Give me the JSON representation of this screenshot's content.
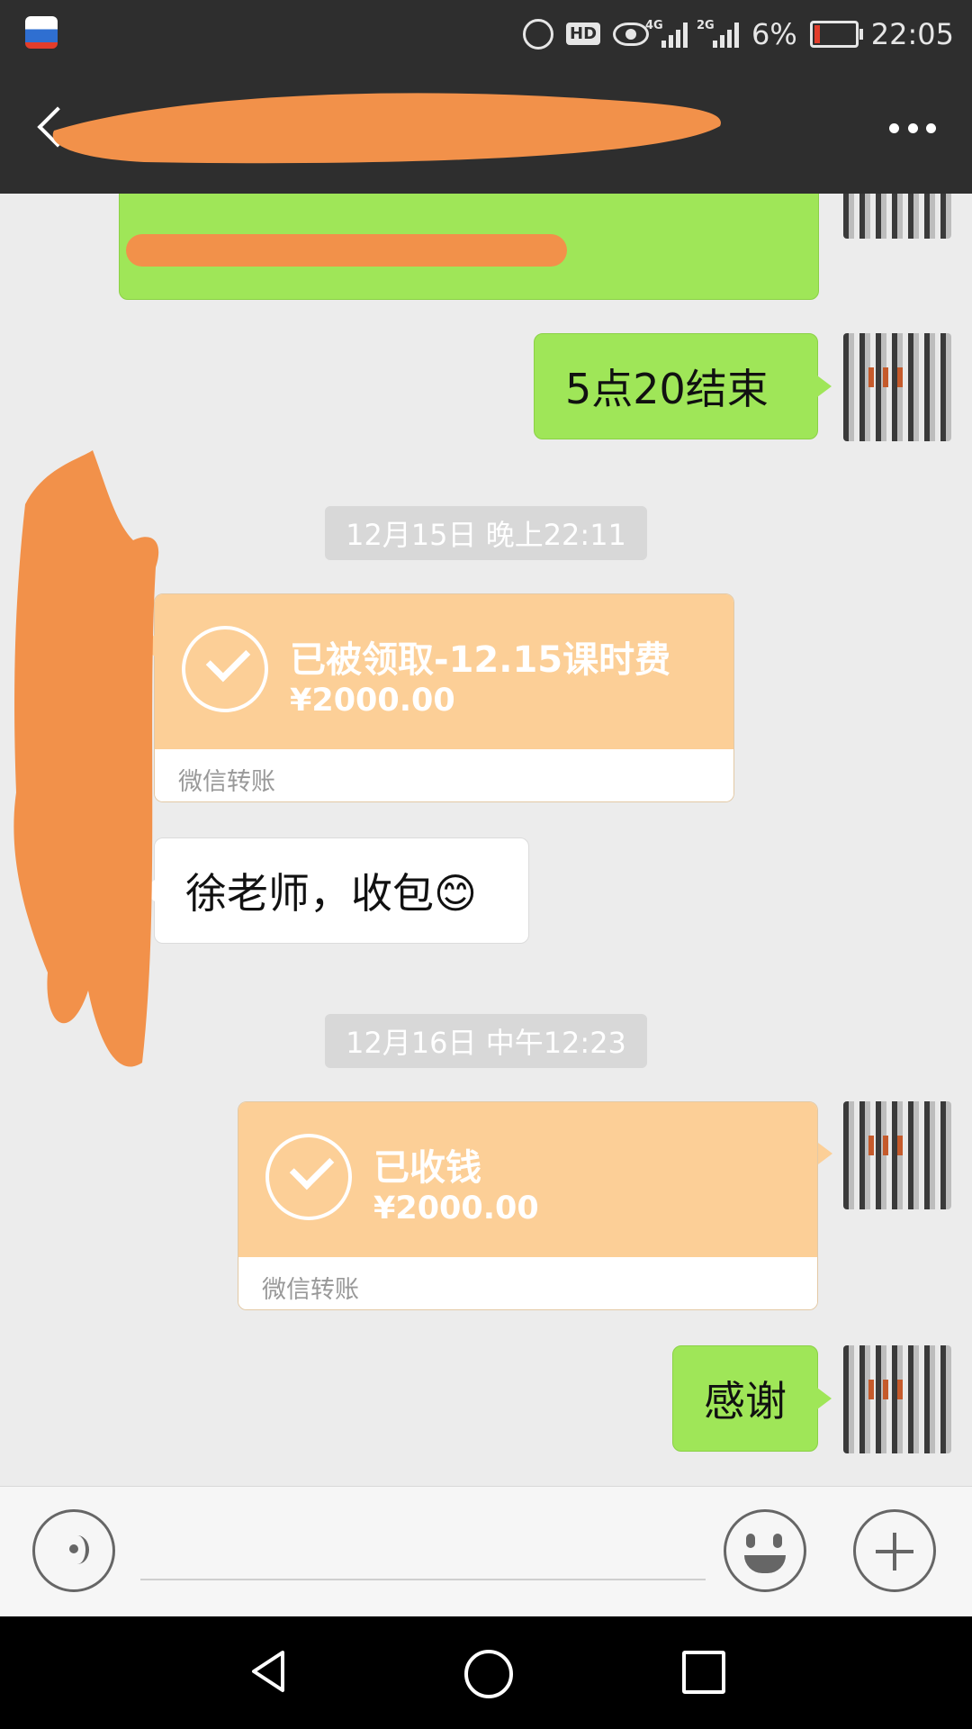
{
  "status_bar": {
    "network_labels": [
      "4G",
      "2G"
    ],
    "battery": "6%",
    "time": "22:05"
  },
  "header": {
    "title": "",
    "back_icon": "chevron-left-icon",
    "more_icon": "more-dots-icon"
  },
  "messages": [
    {
      "type": "text",
      "side": "right",
      "text": "5点20结束"
    },
    {
      "type": "timestamp",
      "text": "12月15日 晚上22:11"
    },
    {
      "type": "transfer",
      "side": "left",
      "title": "已被领取-12.15课时费",
      "amount": "¥2000.00",
      "caption": "微信转账"
    },
    {
      "type": "text",
      "side": "left",
      "text": "徐老师，收包😊"
    },
    {
      "type": "timestamp",
      "text": "12月16日 中午12:23"
    },
    {
      "type": "transfer",
      "side": "right",
      "title": "已收钱",
      "amount": "¥2000.00",
      "caption": "微信转账"
    },
    {
      "type": "text",
      "side": "right",
      "text": "感谢"
    }
  ],
  "input_bar": {
    "placeholder": "",
    "voice_icon": "voice-icon",
    "emoji_icon": "emoji-icon",
    "plus_icon": "plus-icon"
  },
  "colors": {
    "header_bg": "#2e2e2e",
    "chat_bg": "#ececec",
    "own_bubble": "#9fe658",
    "transfer_card": "#fccf97",
    "redaction": "#f2914a"
  }
}
